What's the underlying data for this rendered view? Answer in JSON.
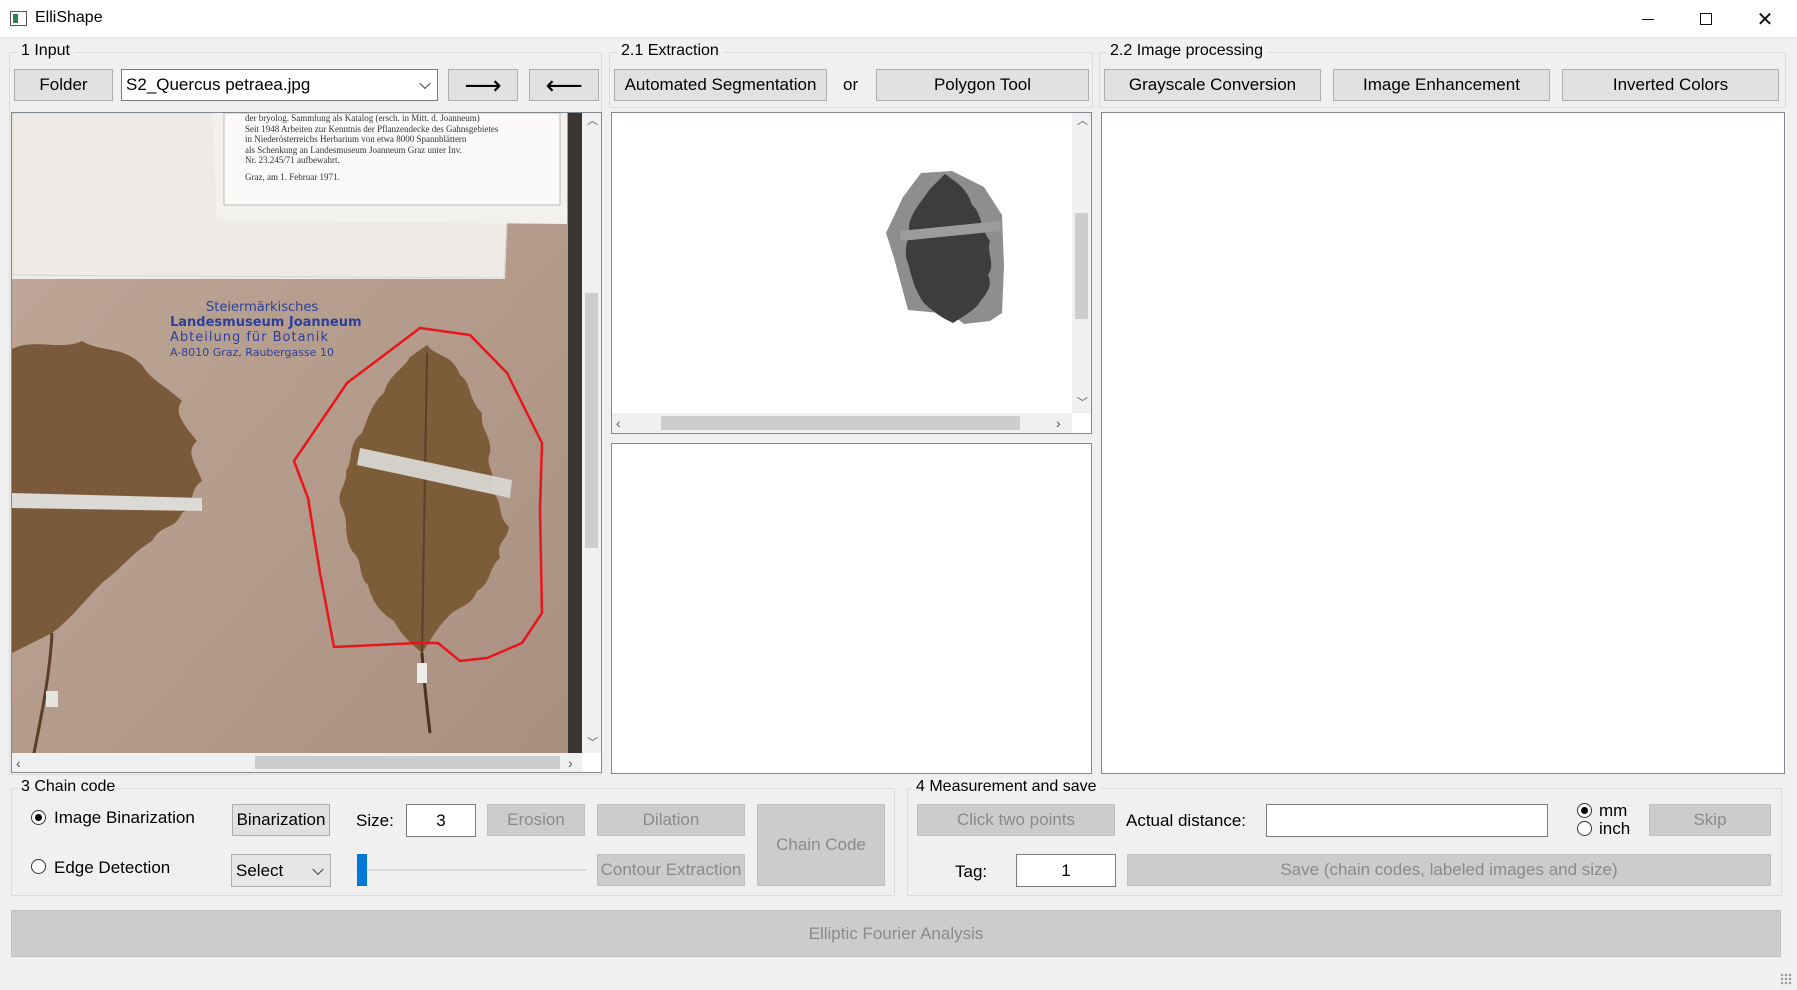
{
  "window": {
    "title": "ElliShape",
    "min_icon": "minimize-icon",
    "max_icon": "maximize-icon",
    "close_icon": "close-icon"
  },
  "input": {
    "group_label": "1 Input",
    "folder_label": "Folder",
    "file_selected": "S2_Quercus petraea.jpg",
    "next_label": "⟶",
    "prev_label": "⟵",
    "stamp_line1": "Steiermärkisches",
    "stamp_line2": "Landesmuseum Joanneum",
    "stamp_line3": "Abteilung für Botanik",
    "stamp_line4": "A-8010 Graz, Raubergasse 10",
    "note_line1": "der bryolog. Sammlung als Katalog (ersch. in Mitt. d. Joanneum)",
    "note_line2": "Seit 1948 Arbeiten zur Kenntnis der Pflanzendecke des Gahnsgebietes",
    "note_line3": "in Niederösterreichs Herbarium von etwa 8000 Spannblättern",
    "note_line4": "als Schenkung an Landesmuseum Joanneum Graz unter Inv.",
    "note_line5": "Nr. 23.245/71 aufbewahrt.",
    "note_line6": "Graz, am 1. Februar 1971."
  },
  "extraction": {
    "group_label": "2.1 Extraction",
    "auto_seg_label": "Automated Segmentation",
    "or_label": "or",
    "polygon_label": "Polygon Tool"
  },
  "processing": {
    "group_label": "2.2 Image processing",
    "grayscale_label": "Grayscale Conversion",
    "enhance_label": "Image Enhancement",
    "invert_label": "Inverted Colors"
  },
  "chain": {
    "group_label": "3 Chain code",
    "binarization_radio": "Image Binarization",
    "edge_radio": "Edge Detection",
    "binarization_btn": "Binarization",
    "size_label": "Size:",
    "size_value": "3",
    "erosion_label": "Erosion",
    "dilation_label": "Dilation",
    "select_label": "Select",
    "contour_label": "Contour Extraction",
    "chain_code_label": "Chain Code",
    "slider_value": 0
  },
  "measure": {
    "group_label": "4 Measurement and save",
    "click_points_label": "Click two points",
    "actual_distance_label": "Actual distance:",
    "actual_distance_value": "",
    "unit_mm": "mm",
    "unit_inch": "inch",
    "skip_label": "Skip",
    "tag_label": "Tag:",
    "tag_value": "1",
    "save_label": "Save (chain codes, labeled images and size)"
  },
  "efa_label": "Elliptic Fourier Analysis",
  "colors": {
    "polygon": "#e8161c",
    "button": "#e1e1e1",
    "disabled": "#cccccc"
  }
}
